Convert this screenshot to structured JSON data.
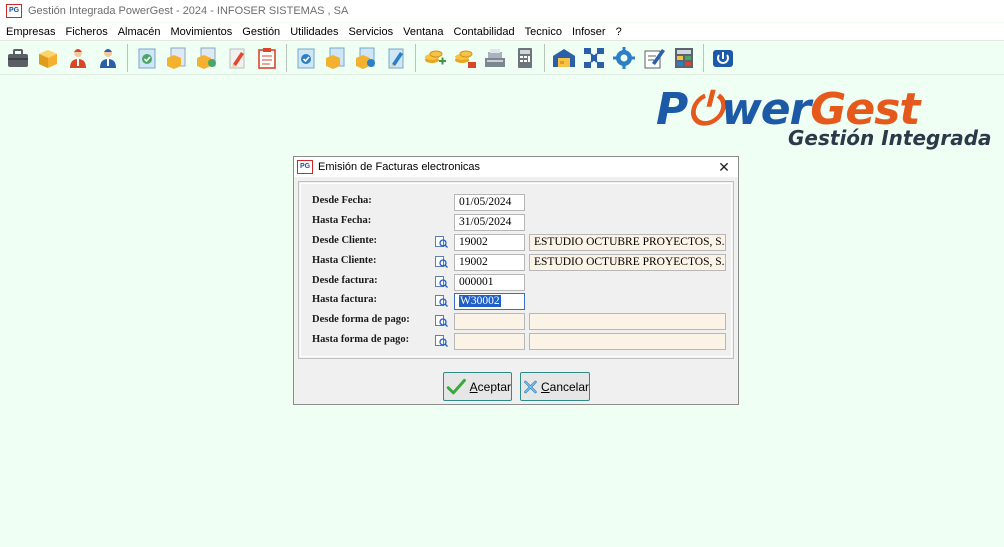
{
  "window": {
    "title": "Gestión Integrada PowerGest - 2024 - INFOSER SISTEMAS , SA",
    "app_icon_text": "PG"
  },
  "menu": [
    "Empresas",
    "Ficheros",
    "Almacén",
    "Movimientos",
    "Gestión",
    "Utilidades",
    "Servicios",
    "Ventana",
    "Contabilidad",
    "Tecnico",
    "Infoser",
    "?"
  ],
  "toolbar": {
    "groups": [
      [
        "briefcase-icon",
        "box-icon",
        "user-red-icon",
        "user-blue-icon"
      ],
      [
        "doc-check-icon",
        "box-doc-icon",
        "box-check-icon",
        "pen-icon",
        "clipboard-icon"
      ],
      [
        "doc-check-blue-icon",
        "box-doc-2-icon",
        "box-check-2-icon",
        "pen-blue-icon"
      ],
      [
        "coins-add-icon",
        "coins-download-icon",
        "cash-register-icon",
        "calculator-icon"
      ],
      [
        "warehouse-icon",
        "network-icon",
        "gear-icon",
        "edit-icon",
        "table-icon"
      ],
      [
        "power-icon"
      ]
    ]
  },
  "logo": {
    "main_part1": "P",
    "main_part2": "wer",
    "main_part3": "Gest",
    "sub": "Gestión Integrada",
    "colors": {
      "blue": "#1c5aa8",
      "orange": "#e55a1c"
    }
  },
  "dialog": {
    "title": "Emisión de Facturas electronicas",
    "close": "✕",
    "fields": {
      "desde_fecha": {
        "label": "Desde Fecha:",
        "value": "01/05/2024"
      },
      "hasta_fecha": {
        "label": "Hasta Fecha:",
        "value": "31/05/2024"
      },
      "desde_cliente": {
        "label": "Desde Cliente:",
        "code": "19002",
        "name": "ESTUDIO OCTUBRE PROYECTOS, S.L.U"
      },
      "hasta_cliente": {
        "label": "Hasta Cliente:",
        "code": "19002",
        "name": "ESTUDIO OCTUBRE PROYECTOS, S.L.U"
      },
      "desde_factura": {
        "label": "Desde factura:",
        "value": "000001"
      },
      "hasta_factura": {
        "label": "Hasta factura:",
        "value": "W30002"
      },
      "desde_forma_pago": {
        "label": "Desde forma de pago:",
        "code": "",
        "name": ""
      },
      "hasta_forma_pago": {
        "label": "Hasta forma de pago:",
        "code": "",
        "name": ""
      }
    },
    "buttons": {
      "ok_underline": "A",
      "ok_rest": "ceptar",
      "cancel_underline": "C",
      "cancel_rest": "ancelar"
    }
  }
}
